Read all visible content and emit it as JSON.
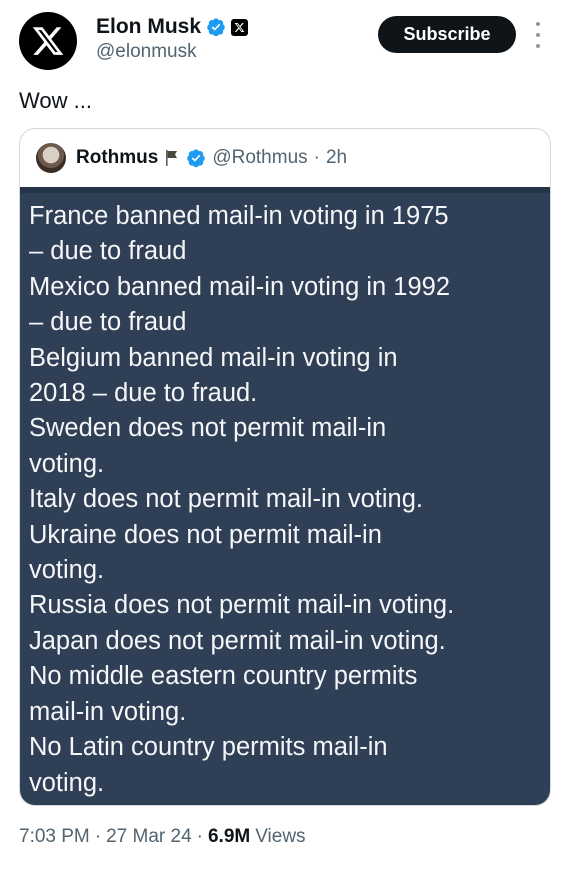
{
  "author": {
    "display_name": "Elon Musk",
    "handle": "@elonmusk"
  },
  "actions": {
    "subscribe_label": "Subscribe"
  },
  "tweet": {
    "text": "Wow ...",
    "timestamp": "7:03 PM",
    "date": "27 Mar 24",
    "views_count": "6.9M",
    "views_label": "Views",
    "separator": "·"
  },
  "quoted_tweet": {
    "display_name": "Rothmus",
    "handle": "@Rothmus",
    "age": "2h",
    "separator": "·",
    "image_text_lines": [
      "France banned mail-in voting in 1975",
      "– due to fraud",
      "Mexico banned mail-in voting in 1992",
      "– due to fraud",
      "Belgium banned mail-in voting in",
      "2018 – due to fraud.",
      "Sweden does not permit mail-in",
      "voting.",
      "Italy does not permit mail-in voting.",
      "Ukraine does not permit mail-in",
      "voting.",
      "Russia does not permit mail-in voting.",
      "Japan does not permit mail-in voting.",
      "No middle eastern country permits",
      "mail-in voting.",
      "No Latin country permits mail-in",
      "voting."
    ]
  },
  "icons": {
    "avatar": "x-logo-icon",
    "verified": "verified-badge-icon",
    "affiliation": "x-affiliation-icon",
    "more": "more-vertical-icon",
    "flag": "flag-icon"
  },
  "colors": {
    "verified_blue": "#1d9bf0",
    "text_primary": "#0f1419",
    "text_secondary": "#536471",
    "image_background": "#2f3f55"
  }
}
